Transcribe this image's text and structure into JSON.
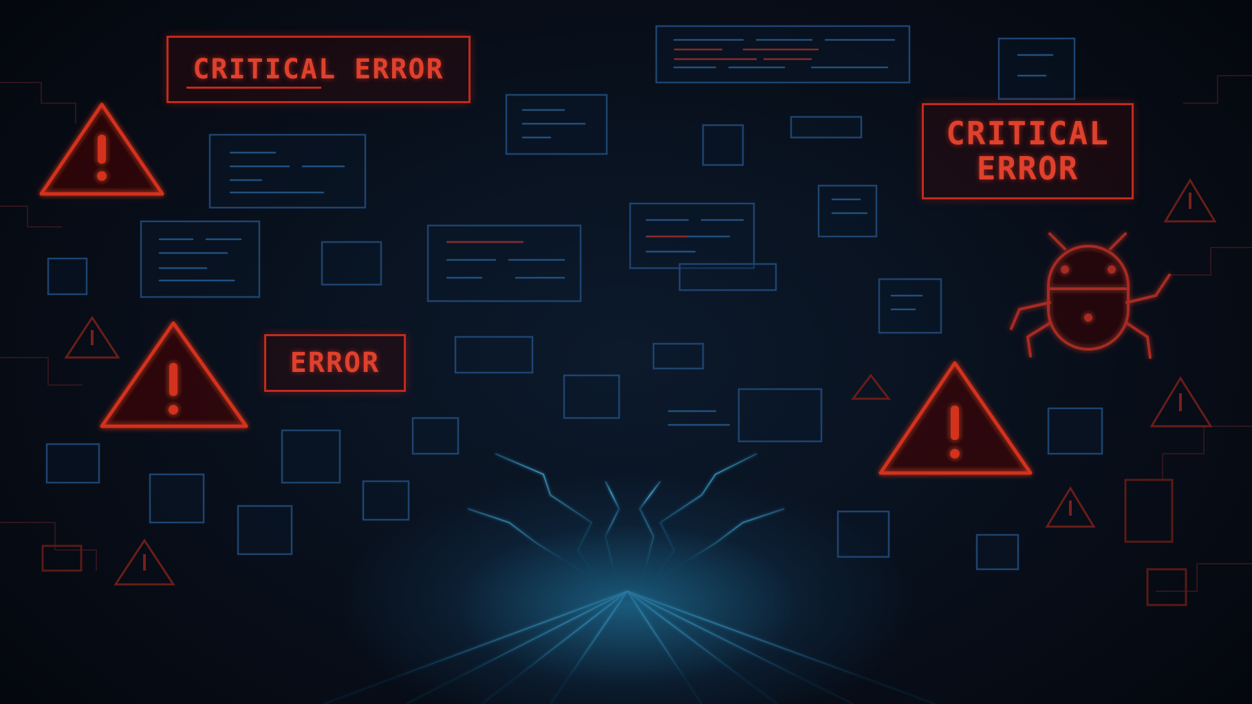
{
  "banners": {
    "critical_error_left": "CRITICAL ERROR",
    "critical_error_right": "CRITICAL\nERROR",
    "error_mid": "ERROR"
  },
  "colors": {
    "alert_red": "#d3301f",
    "panel_blue": "#1c3f66",
    "glow_cyan": "#38a8d8",
    "background": "#070c16"
  },
  "icons": [
    "warning-triangle-icon",
    "bug-icon"
  ]
}
